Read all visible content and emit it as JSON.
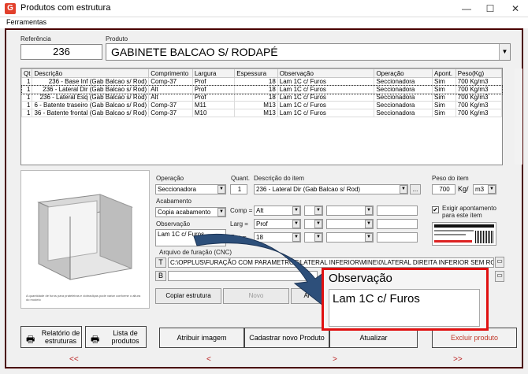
{
  "window": {
    "title": "Produtos com estrutura",
    "app_icon": "app-logo-icon",
    "app_icon_glyph": "G",
    "minimize": "—",
    "maximize": "☐",
    "close": "✕"
  },
  "menu": {
    "items": [
      "Ferramentas"
    ]
  },
  "header": {
    "referencia_label": "Referência",
    "referencia_value": "236",
    "produto_label": "Produto",
    "produto_value": "GABINETE BALCAO S/ RODAPÉ"
  },
  "table": {
    "columns": [
      "Qt",
      "Descrição",
      "Comprimento",
      "Largura",
      "Espessura",
      "Observação",
      "Operação",
      "Apont.",
      "Peso(Kg)"
    ],
    "rows": [
      [
        "1",
        "236 - Base Inf (Gab Balcao s/ Rod)",
        "Comp-37",
        "Prof",
        "18",
        "Lam 1C c/ Furos",
        "Seccionadora",
        "Sim",
        "700 Kg/m3"
      ],
      [
        "1",
        "236 - Lateral Dir (Gab Balcao s/ Rod)",
        "Alt",
        "Prof",
        "18",
        "Lam 1C c/ Furos",
        "Seccionadora",
        "Sim",
        "700 Kg/m3"
      ],
      [
        "1",
        "236 - Lateral Esq (Gab Balcao s/ Rod)",
        "Alt",
        "Prof",
        "18",
        "Lam 1C c/ Furos",
        "Seccionadora",
        "Sim",
        "700 Kg/m3"
      ],
      [
        "1",
        "6 - Batente traseiro (Gab Balcao s/ Rod)",
        "Comp-37",
        "M11",
        "M13",
        "Lam 1C c/ Furos",
        "Seccionadora",
        "Sim",
        "700 Kg/m3"
      ],
      [
        "1",
        "36 - Batente frontal (Gab Balcao s/ Rod)",
        "Comp-37",
        "M10",
        "M13",
        "Lam 1C c/ Furos",
        "Seccionadora",
        "Sim",
        "700 Kg/m3"
      ]
    ]
  },
  "image_caption": "A quantidade de furos para prateleiras e dobradiças pode variar conforme o altura do modelo",
  "form": {
    "operacao_label": "Operação",
    "operacao_value": "Seccionadora",
    "quant_label": "Quant.",
    "quant_value": "1",
    "descricao_label": "Descrição do item",
    "descricao_value": "236 - Lateral Dir (Gab Balcao s/ Rod)",
    "ellipsis": "...",
    "peso_label": "Peso do item",
    "peso_value": "700",
    "peso_unit": "Kg/",
    "peso_unit2": "m3",
    "acabamento_label": "Acabamento",
    "acabamento_value": "Copia acabamento",
    "comp_label": "Comp =",
    "comp_value": "Alt",
    "larg_label": "Larg =",
    "larg_value": "Prof",
    "esp_label": "Esp =",
    "esp_value": "18",
    "observacao_label": "Observação",
    "observacao_value": "Lam 1C c/ Furos",
    "exigir_label": "Exigir apontamento para este item",
    "exigir_checked": "✔",
    "arquivo_label": "Arquivo de furação (CNC)",
    "arquivo_value": "C:\\OPPLUS\\FURAÇÃO COM PARAMETROS\\LATERAL INFERIOR\\MINE\\0\\LATERAL DIREITA INFERIOR SEM RODAPE GBS",
    "copiar_label": "Copiar estrutura",
    "novo_label": "Novo",
    "al_label": "Al"
  },
  "actions": {
    "relatorio": "Relatório de estruturas",
    "lista": "Lista de produtos",
    "atribuir": "Atribuir imagem",
    "cadastrar": "Cadastrar novo Produto",
    "atualizar": "Atualizar",
    "excluir": "Excluir produto"
  },
  "nav": {
    "first": "<<",
    "prev": "<",
    "next": ">",
    "last": ">>"
  },
  "zoom": {
    "title": "Observação",
    "value": "Lam 1C c/ Furos"
  },
  "colors": {
    "frame": "#4a0000",
    "highlight": "#e01010",
    "arrow": "#2d4f7a",
    "excluir_text": "#c0392b"
  }
}
